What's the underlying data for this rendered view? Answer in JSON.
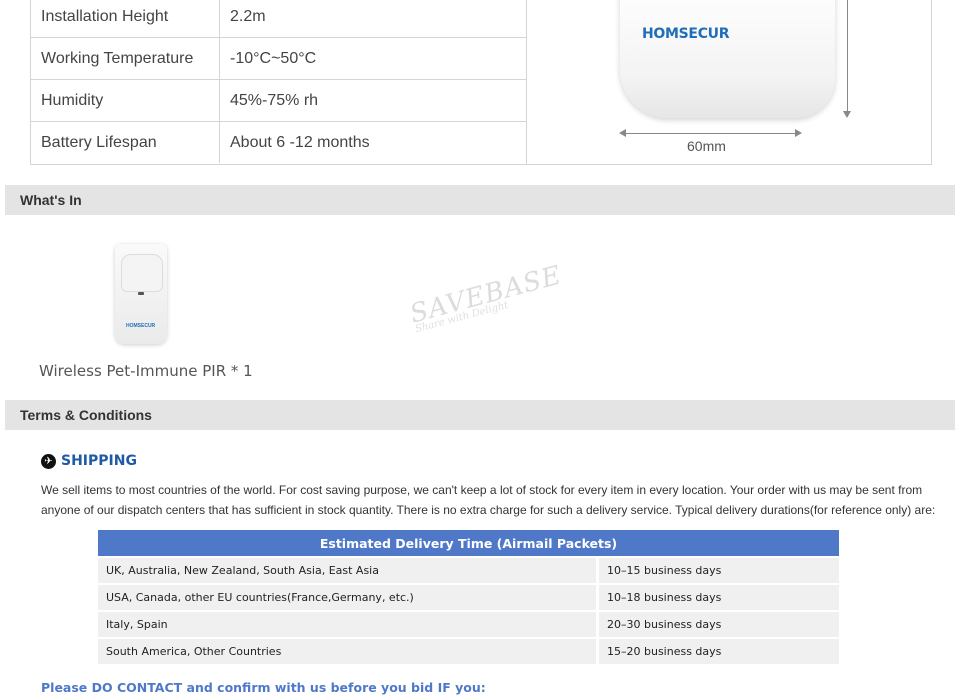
{
  "specs": [
    {
      "label": "Installation Height",
      "value": "2.2m"
    },
    {
      "label": "Working Temperature",
      "value": "-10°C~50°C"
    },
    {
      "label": "Humidity",
      "value": "45%-75% rh"
    },
    {
      "label": "Battery Lifespan",
      "value": "About 6 -12 months"
    }
  ],
  "product_image": {
    "brand": "HOMSECUR",
    "dimension_label": "60mm"
  },
  "whats_in": {
    "heading": "What's In",
    "item_label": "Wireless Pet-Immune PIR * 1",
    "mini_brand": "HOMSECUR",
    "watermark": "SAVEBASE",
    "watermark_sub": "Share with Delight"
  },
  "terms": {
    "heading": "Terms & Conditions"
  },
  "shipping": {
    "icon": "plane-icon",
    "title": "SHIPPING",
    "description": "We sell items to most countries of the world. For cost saving purpose, we can't keep a lot of stock for every item in every location. Your order with us may be sent from anyone of our dispatch centers that has sufficient in stock quantity. There is no extra charge for such a delivery service. Typical delivery durations(for reference only) are:",
    "table_header": "Estimated Delivery Time (Airmail Packets)",
    "rows": [
      {
        "region": "UK, Australia, New Zealand, South Asia, East Asia",
        "time": "10–15 business days"
      },
      {
        "region": "USA, Canada, other EU countries(France,Germany, etc.)",
        "time": "10–18 business days"
      },
      {
        "region": "Italy, Spain",
        "time": "20–30 business days"
      },
      {
        "region": "South America, Other Countries",
        "time": "15–20 business days"
      }
    ],
    "contact_note": "Please DO CONTACT and confirm with us before you bid IF you:"
  },
  "colors": {
    "accent": "#4f79c8",
    "brand": "#1e6fb8",
    "section_bar": "#e4e4e4"
  }
}
